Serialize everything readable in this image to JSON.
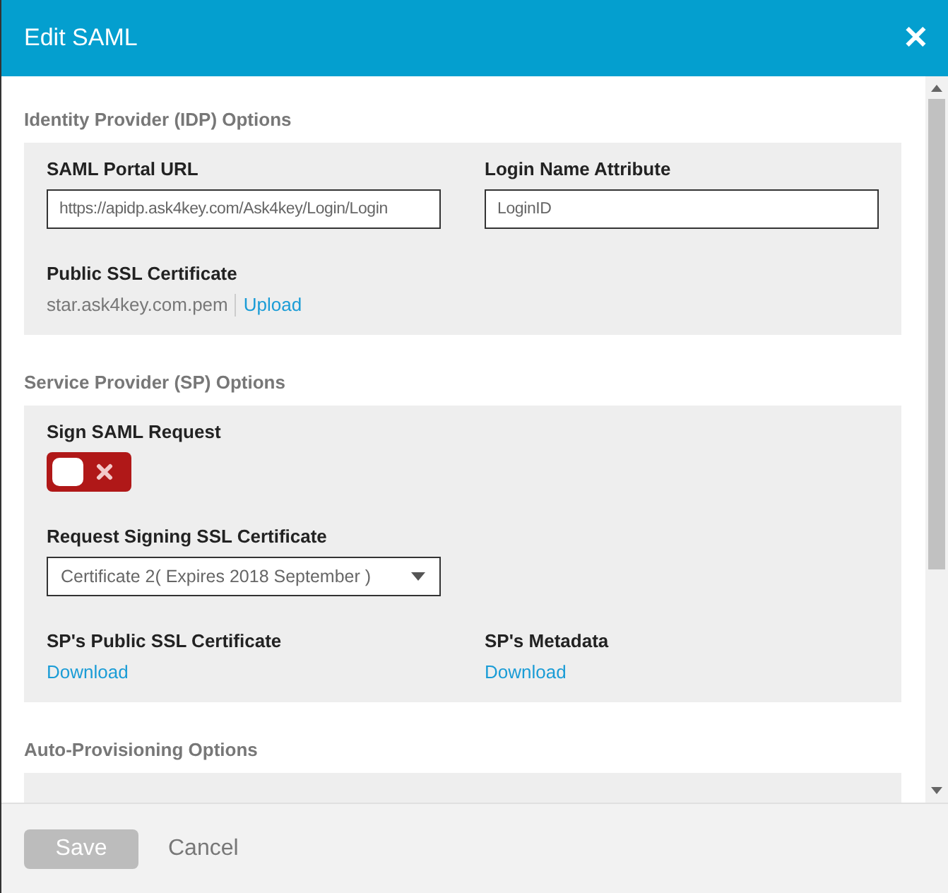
{
  "window": {
    "title": "Edit SAML",
    "close": "✕"
  },
  "sections": [
    {
      "title": "Identity Provider (IDP) Options",
      "fields": [
        {
          "kind": "input",
          "label": "SAML Portal URL",
          "value": "https://apidp.ask4key.com/Ask4key/Login/Login"
        },
        {
          "kind": "input",
          "label": "Login Name Attribute",
          "value": "LoginID"
        },
        {
          "kind": "file",
          "label": "Public SSL Certificate",
          "value": "star.ask4key.com.pem",
          "link": "Upload"
        }
      ]
    },
    {
      "title": "Service Provider (SP) Options",
      "fields": [
        {
          "kind": "toggle",
          "label": "Sign SAML Request",
          "on": false
        },
        {
          "kind": "blank"
        },
        {
          "kind": "select",
          "label": "Request Signing SSL Certificate",
          "value": "Certificate 2( Expires 2018 September )"
        },
        {
          "kind": "blank"
        },
        {
          "kind": "link",
          "label": "SP's Public SSL Certificate",
          "link": "Download"
        },
        {
          "kind": "link",
          "label": "SP's Metadata",
          "link": "Download"
        }
      ]
    },
    {
      "title": "Auto-Provisioning Options"
    }
  ],
  "footer": {
    "save": {
      "label": "Save",
      "disabled": true
    },
    "cancel": "Cancel"
  }
}
